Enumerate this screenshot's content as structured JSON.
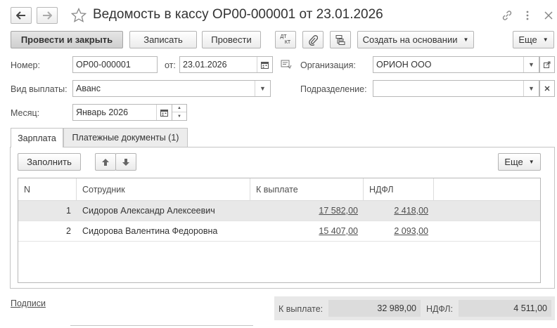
{
  "window": {
    "title": "Ведомость в кассу ОР00-000001 от 23.01.2026"
  },
  "toolbar": {
    "post_and_close": "Провести и закрыть",
    "save": "Записать",
    "post": "Провести",
    "dt_kt_top": "ДТ",
    "dt_kt_bottom": "КТ",
    "create_based_on": "Создать на основании",
    "more": "Еще"
  },
  "form": {
    "number_label": "Номер:",
    "number_value": "ОР00-000001",
    "date_label": "от:",
    "date_value": "23.01.2026",
    "organization_label": "Организация:",
    "organization_value": "ОРИОН ООО",
    "payment_type_label": "Вид выплаты:",
    "payment_type_value": "Аванс",
    "department_label": "Подразделение:",
    "department_value": "",
    "month_label": "Месяц:",
    "month_value": "Январь 2026"
  },
  "tabs": [
    {
      "label": "Зарплата",
      "active": true
    },
    {
      "label": "Платежные документы (1)",
      "active": false
    }
  ],
  "table_toolbar": {
    "fill": "Заполнить",
    "more": "Еще"
  },
  "table": {
    "columns": [
      "N",
      "Сотрудник",
      "К выплате",
      "НДФЛ"
    ],
    "rows": [
      {
        "n": "1",
        "employee": "Сидоров Александр Алексеевич",
        "to_pay": "17 582,00",
        "ndfl": "2 418,00",
        "selected": true
      },
      {
        "n": "2",
        "employee": "Сидорова Валентина Федоровна",
        "to_pay": "15 407,00",
        "ndfl": "2 093,00",
        "selected": false
      }
    ]
  },
  "footer": {
    "signatures_link": "Подписи",
    "to_pay_label": "К выплате:",
    "to_pay_total": "32 989,00",
    "ndfl_label": "НДФЛ:",
    "ndfl_total": "4 511,00"
  }
}
